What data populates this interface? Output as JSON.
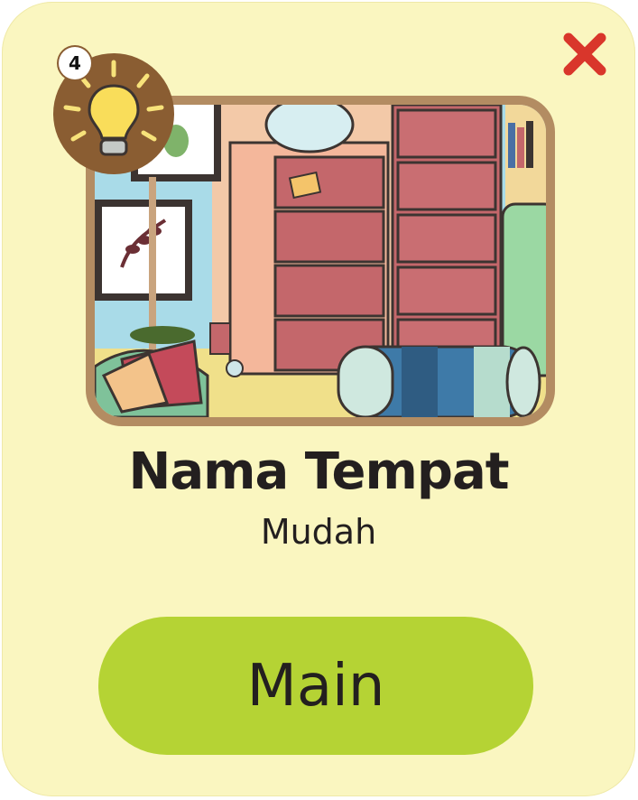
{
  "level": {
    "title": "Nama Tempat",
    "difficulty": "Mudah",
    "scene_image": "cluttered-room-illustration"
  },
  "hint": {
    "count": "4",
    "icon": "lightbulb-icon"
  },
  "actions": {
    "play_label": "Main",
    "close_icon": "close-icon"
  },
  "colors": {
    "card_bg": "#faf6c0",
    "frame": "#b38c62",
    "hint_bg": "#8a5d32",
    "play_bg": "#b5d334",
    "close_red": "#d9362b",
    "text": "#231f1f"
  }
}
